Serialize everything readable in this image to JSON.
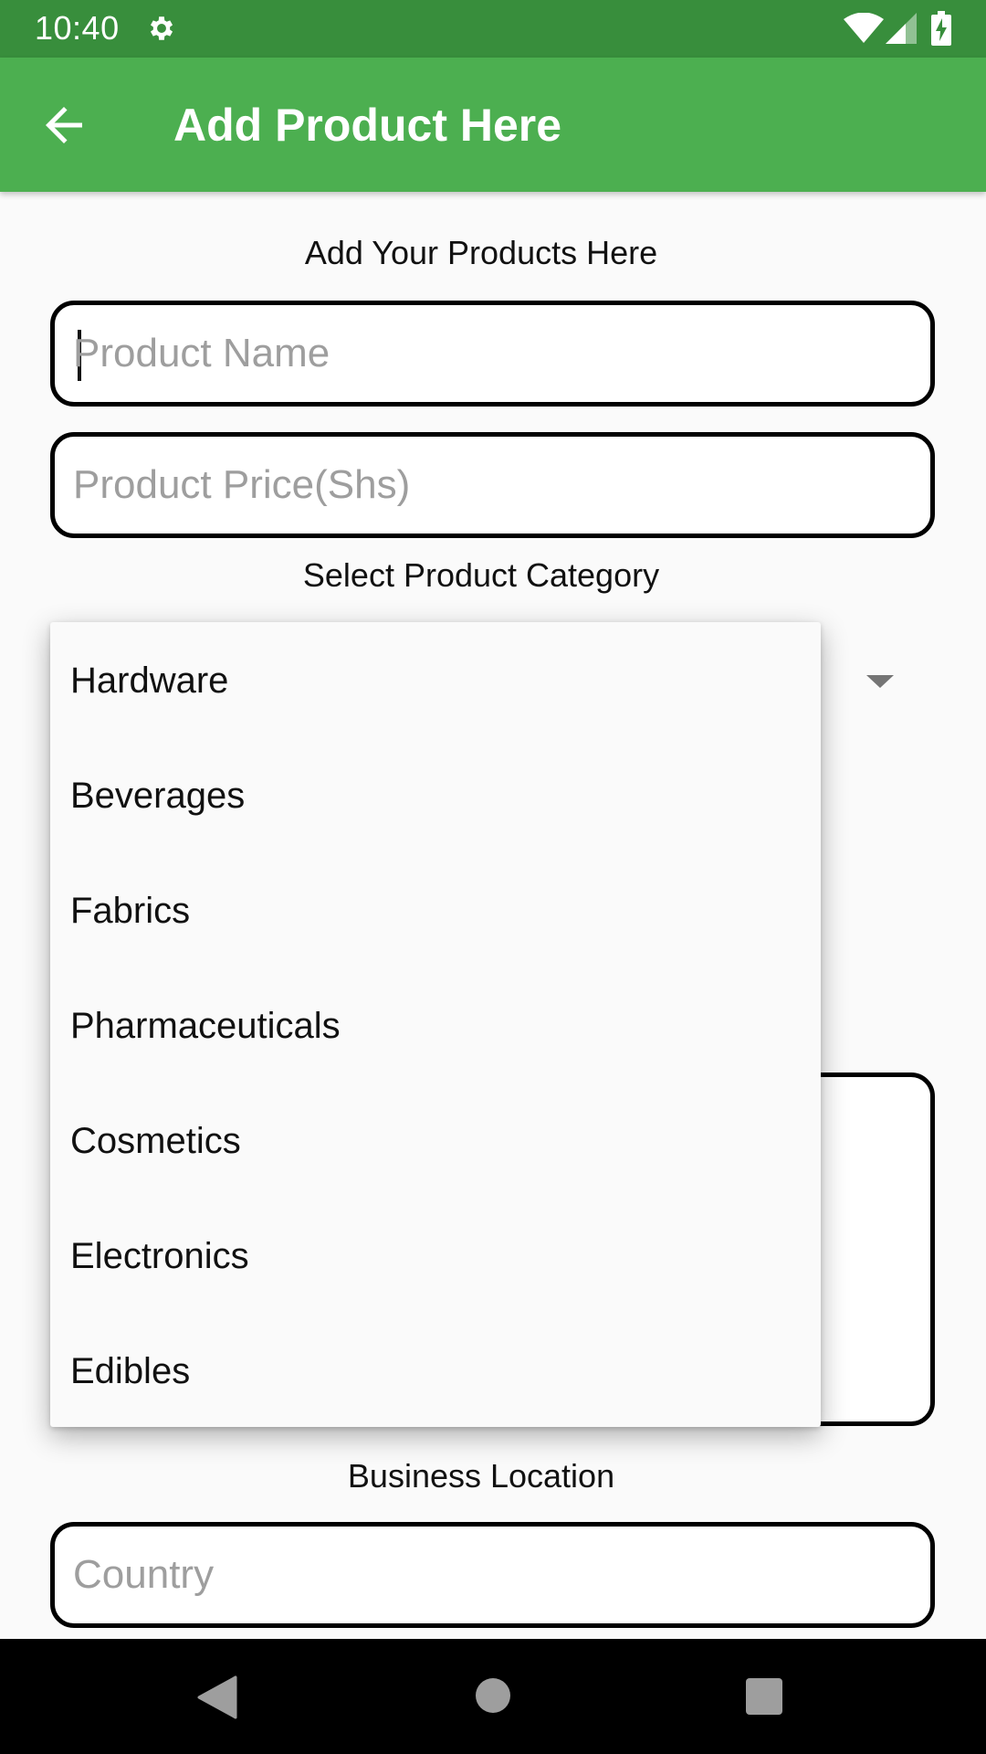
{
  "status_bar": {
    "time": "10:40",
    "icons": [
      "gear-icon",
      "wifi-icon",
      "signal-icon",
      "battery-charging-icon"
    ]
  },
  "app_bar": {
    "title": "Add Product Here",
    "back_icon": "arrow-back-icon",
    "color": "#4caf50",
    "status_color": "#388e3c"
  },
  "form": {
    "heading": "Add Your Products Here",
    "product_name": {
      "value": "",
      "placeholder": "Product Name"
    },
    "product_price": {
      "value": "",
      "placeholder": "Product Price(Shs)"
    },
    "category_label": "Select Product Category",
    "location_label": "Business Location",
    "country": {
      "value": "",
      "placeholder": "Country"
    }
  },
  "category_dropdown": {
    "expanded": true,
    "options": [
      "Hardware",
      "Beverages",
      "Fabrics",
      "Pharmaceuticals",
      "Cosmetics",
      "Electronics",
      "Edibles"
    ]
  },
  "nav_bar": {
    "icons": [
      "nav-back-icon",
      "nav-home-icon",
      "nav-recents-icon"
    ]
  }
}
